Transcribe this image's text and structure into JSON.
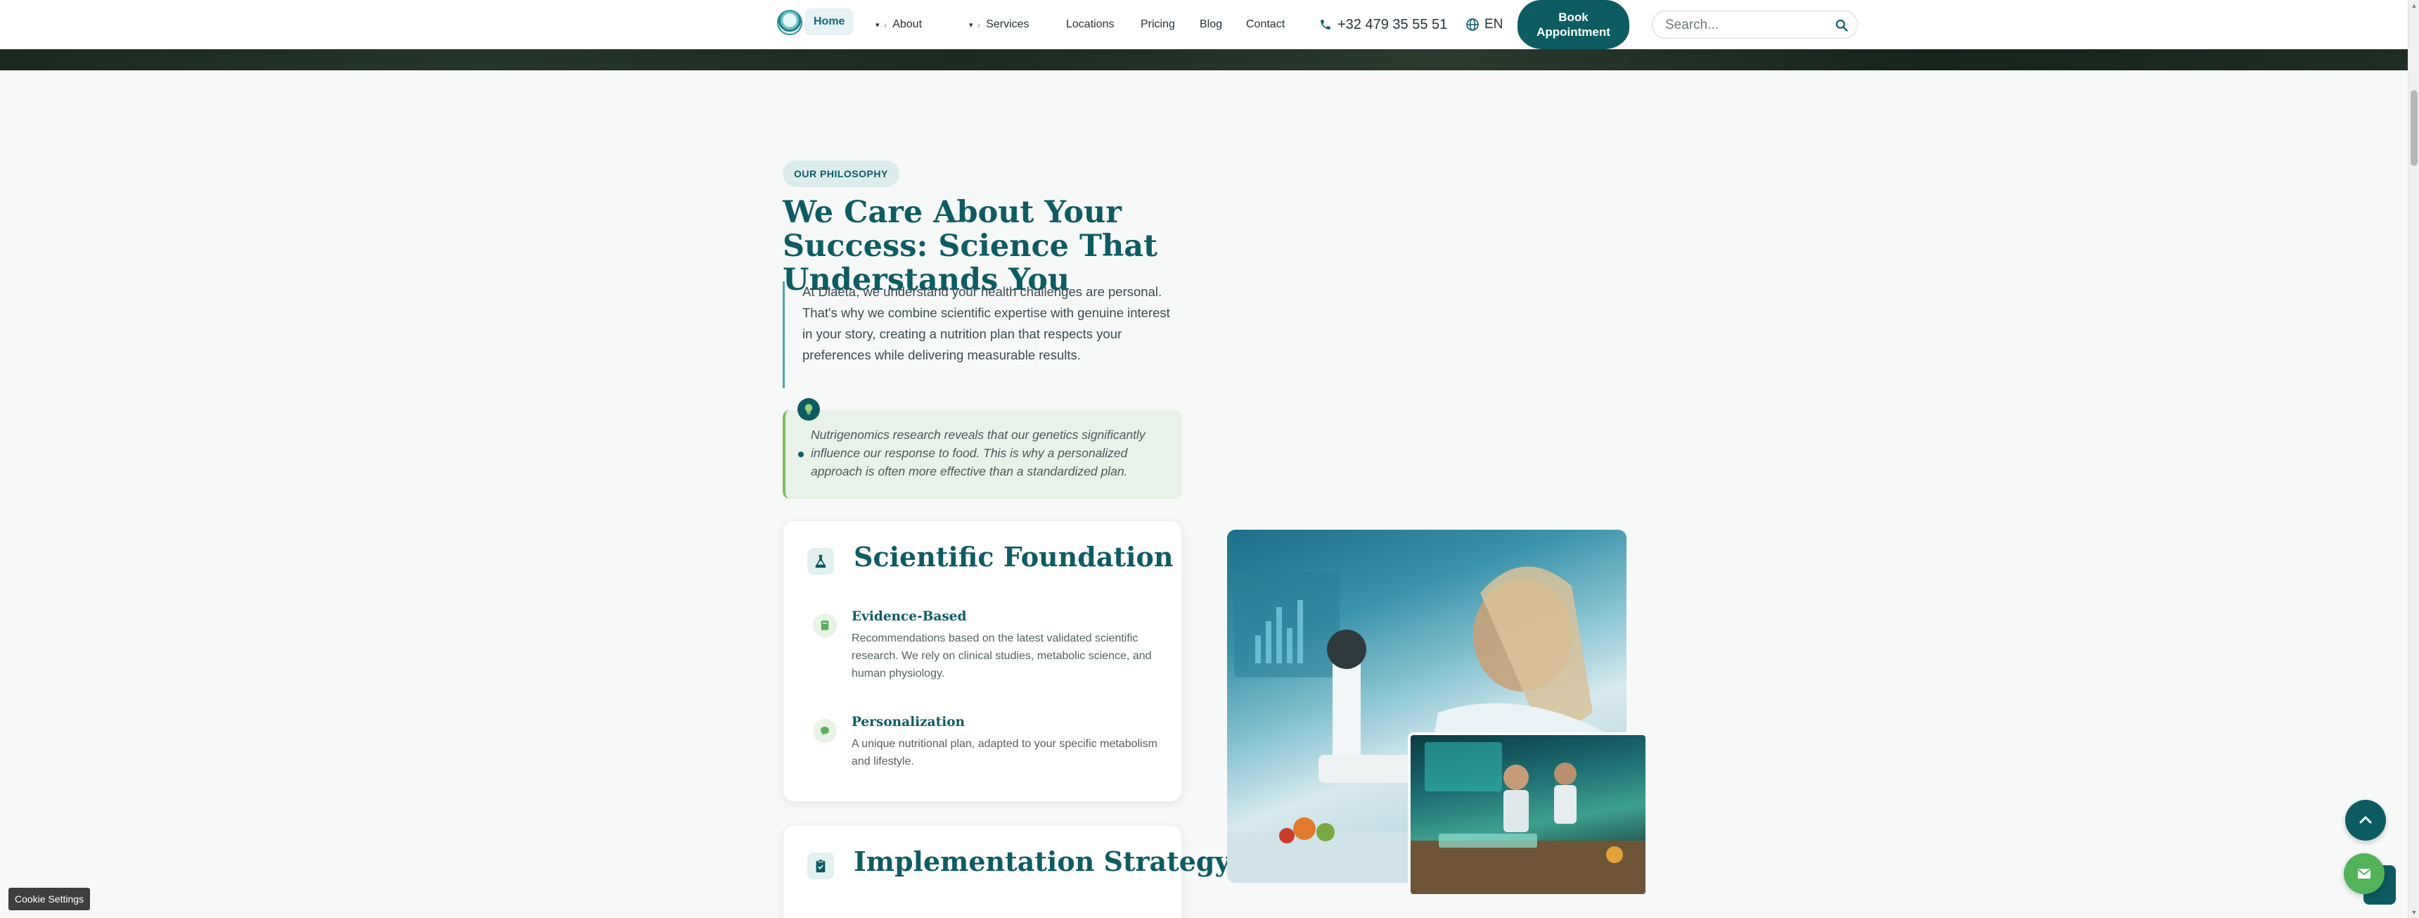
{
  "nav": {
    "home": "Home",
    "about": "About",
    "services": "Services",
    "locations": "Locations",
    "pricing": "Pricing",
    "blog": "Blog",
    "contact": "Contact",
    "phone": "+32 479 35 55 51",
    "language": "EN",
    "book_label": "Book Appointment",
    "search_placeholder": "Search...",
    "caret": "▾",
    "chevron": "›"
  },
  "philosophy": {
    "badge": "OUR PHILOSOPHY",
    "title": "We Care About Your Success: Science That Understands You",
    "intro": "At Diaeta, we understand your health challenges are personal. That's why we combine scientific expertise with genuine interest in your story, creating a nutrition plan that respects your preferences while delivering measurable results.",
    "note": "Nutrigenomics research reveals that our genetics significantly influence our response to food. This is why a personalized approach is often more effective than a standardized plan."
  },
  "cards": {
    "scientific": {
      "title": "Scientific Foundation",
      "features": [
        {
          "title": "Evidence-Based",
          "desc": "Recommendations based on the latest validated scientific research. We rely on clinical studies, metabolic science, and human physiology."
        },
        {
          "title": "Personalization",
          "desc": "A unique nutritional plan, adapted to your specific metabolism and lifestyle."
        }
      ]
    },
    "implementation": {
      "title": "Implementation Strategy"
    }
  },
  "cookie": "Cookie Settings",
  "colors": {
    "primary": "#0d5c63",
    "accent_green": "#52b35b",
    "badge_bg": "#dcecec",
    "note_bg": "#e9f2e8"
  },
  "icons": [
    "phone-icon",
    "globe-icon",
    "search-icon",
    "flask-icon",
    "book-icon",
    "brain-icon",
    "clipboard-check-icon",
    "lightbulb-icon",
    "chevron-up-icon",
    "mail-icon"
  ]
}
